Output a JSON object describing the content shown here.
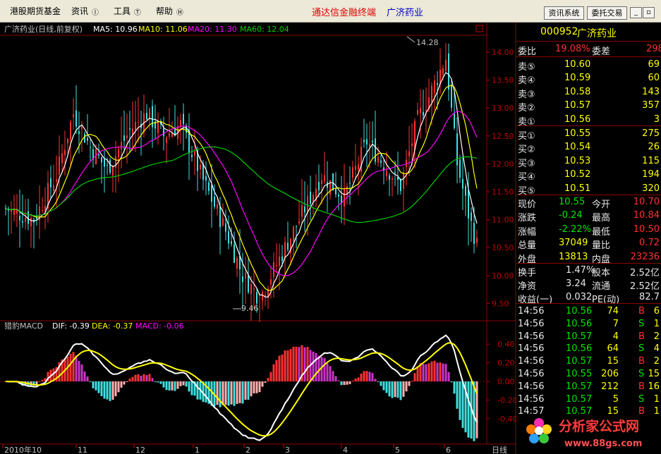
{
  "menu": {
    "items": [
      "港股期货基金",
      "资讯",
      "工具",
      "帮助"
    ],
    "app_title": "通达信金融终端",
    "stock_name": "广济药业",
    "btn_news": "资讯系统",
    "btn_trade": "委托交易"
  },
  "kline": {
    "title": "广济药业(日线,前复权)",
    "ma5": "MA5: 10.96",
    "ma10": "MA10: 11.06",
    "ma20": "MA20: 11.30",
    "ma60": "MA60: 12.04",
    "high_mark": "14.28",
    "low_mark": "9.46",
    "y_ticks": [
      "14.00",
      "13.50",
      "13.00",
      "12.50",
      "12.00",
      "11.50",
      "11.00",
      "10.50",
      "10.00",
      "9.50"
    ]
  },
  "macd": {
    "title": "猎豹MACD",
    "dif": "DIF: -0.39",
    "dea": "DEA: -0.37",
    "macd": "MACD: -0.06",
    "y_ticks": [
      "0.40",
      "0.20",
      "0.00",
      "-0.20",
      "-0.40"
    ]
  },
  "x_axis": {
    "labels": [
      "2010年10",
      "11",
      "12",
      "1",
      "2",
      "3",
      "4",
      "5",
      "6"
    ],
    "period": "日线"
  },
  "quote": {
    "code": "000952",
    "name": "广济药业",
    "weibi_label": "委比",
    "weibi": "19.08%",
    "weicha_label": "委差",
    "weicha": "298",
    "asks": [
      {
        "label": "卖⑤",
        "price": "10.60",
        "vol": "69"
      },
      {
        "label": "卖④",
        "price": "10.59",
        "vol": "60"
      },
      {
        "label": "卖③",
        "price": "10.58",
        "vol": "143"
      },
      {
        "label": "卖②",
        "price": "10.57",
        "vol": "357"
      },
      {
        "label": "卖①",
        "price": "10.56",
        "vol": "3"
      }
    ],
    "bids": [
      {
        "label": "买①",
        "price": "10.55",
        "vol": "275"
      },
      {
        "label": "买②",
        "price": "10.54",
        "vol": "26"
      },
      {
        "label": "买③",
        "price": "10.53",
        "vol": "115"
      },
      {
        "label": "买④",
        "price": "10.52",
        "vol": "194"
      },
      {
        "label": "买⑤",
        "price": "10.51",
        "vol": "320"
      }
    ],
    "stats": [
      {
        "l1": "现价",
        "v1": "10.55",
        "l2": "今开",
        "v2": "10.70"
      },
      {
        "l1": "涨跌",
        "v1": "-0.24",
        "l2": "最高",
        "v2": "10.84"
      },
      {
        "l1": "涨幅",
        "v1": "-2.22%",
        "l2": "最低",
        "v2": "10.50"
      },
      {
        "l1": "总量",
        "v1": "37049",
        "l2": "量比",
        "v2": "0.72"
      },
      {
        "l1": "外盘",
        "v1": "13813",
        "l2": "内盘",
        "v2": "23236"
      }
    ],
    "stats2": [
      {
        "l1": "换手",
        "v1": "1.47%",
        "l2": "股本",
        "v2": "2.52亿"
      },
      {
        "l1": "净资",
        "v1": "3.24",
        "l2": "流通",
        "v2": "2.52亿"
      },
      {
        "l1": "收益(一)",
        "v1": "0.032",
        "l2": "PE(动)",
        "v2": "82.7"
      }
    ],
    "ticks": [
      {
        "time": "14:56",
        "price": "10.56",
        "vol": "74",
        "bs": "B",
        "n": "6"
      },
      {
        "time": "14:56",
        "price": "10.56",
        "vol": "7",
        "bs": "S",
        "n": "1"
      },
      {
        "time": "14:56",
        "price": "10.57",
        "vol": "4",
        "bs": "B",
        "n": "2"
      },
      {
        "time": "14:56",
        "price": "10.56",
        "vol": "64",
        "bs": "S",
        "n": "4"
      },
      {
        "time": "14:56",
        "price": "10.57",
        "vol": "15",
        "bs": "B",
        "n": "2"
      },
      {
        "time": "14:56",
        "price": "10.55",
        "vol": "206",
        "bs": "S",
        "n": "15"
      },
      {
        "time": "14:56",
        "price": "10.57",
        "vol": "212",
        "bs": "B",
        "n": "16"
      },
      {
        "time": "14:56",
        "price": "10.57",
        "vol": "5",
        "bs": "S",
        "n": "1"
      },
      {
        "time": "14:57",
        "price": "10.57",
        "vol": "15",
        "bs": "B",
        "n": "1"
      }
    ]
  },
  "watermark": {
    "brand": "分析家公式网",
    "url": "www.88gs.com"
  },
  "colors": {
    "up": "#ff3232",
    "down": "#40e0e0",
    "ma5": "#ffffff",
    "ma10": "#ffff00",
    "ma20": "#ff00ff",
    "ma60": "#00cc00",
    "grid": "#8b0000"
  }
}
